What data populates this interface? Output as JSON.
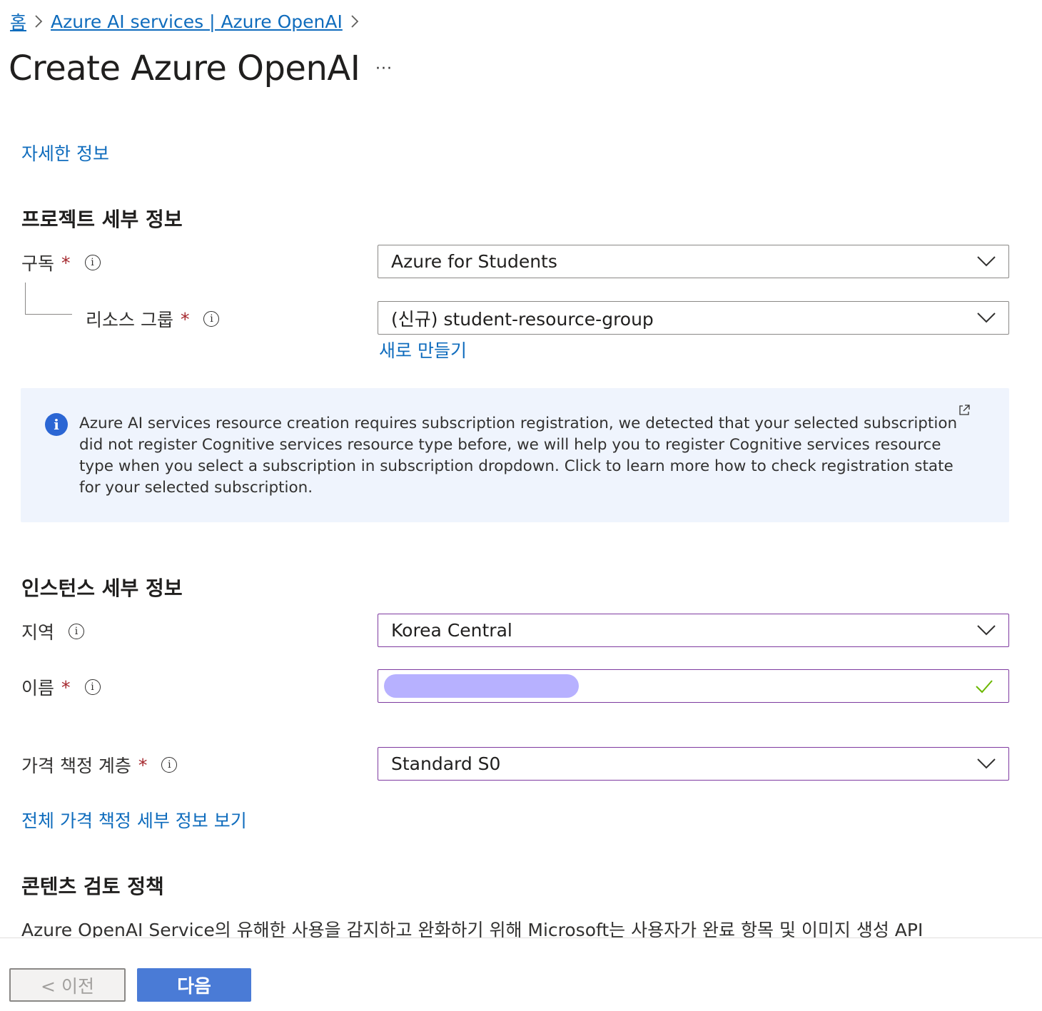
{
  "breadcrumb": {
    "home": "홈",
    "parent": "Azure AI services | Azure OpenAI"
  },
  "page": {
    "title": "Create Azure OpenAI",
    "more": "···",
    "learn_more": "자세한 정보"
  },
  "project": {
    "heading": "프로젝트 세부 정보",
    "subscription_label": "구독",
    "subscription_value": "Azure for Students",
    "resource_group_label": "리소스 그룹",
    "resource_group_value": "(신규) student-resource-group",
    "create_new": "새로 만들기"
  },
  "infobar": {
    "text": "Azure AI services resource creation requires subscription registration, we detected that your selected subscription did not register Cognitive services resource type before, we will help you to register Cognitive services resource type when you select a subscription in subscription dropdown. Click to learn more how to check registration state for your selected subscription."
  },
  "instance": {
    "heading": "인스턴스 세부 정보",
    "region_label": "지역",
    "region_value": "Korea Central",
    "name_label": "이름",
    "name_value": "",
    "pricing_label": "가격 책정 계층",
    "pricing_value": "Standard S0",
    "pricing_link": "전체 가격 책정 세부 정보 보기"
  },
  "policy": {
    "heading": "콘텐츠 검토 정책",
    "text": "Azure OpenAI Service의 유해한 사용을 감지하고 완화하기 위해 Microsoft는 사용자가 완료 항목 및 이미지 생성 API"
  },
  "footer": {
    "prev": "< 이전",
    "next": "다음"
  },
  "required_mark": "*",
  "info_glyph": "i",
  "colors": {
    "link": "#0f6cbd",
    "required": "#a4262c",
    "focus_border": "#7e3aa0",
    "primary_button": "#4a7bd6",
    "infobar_bg": "#eff4fd",
    "valid_check": "#6bb700"
  }
}
